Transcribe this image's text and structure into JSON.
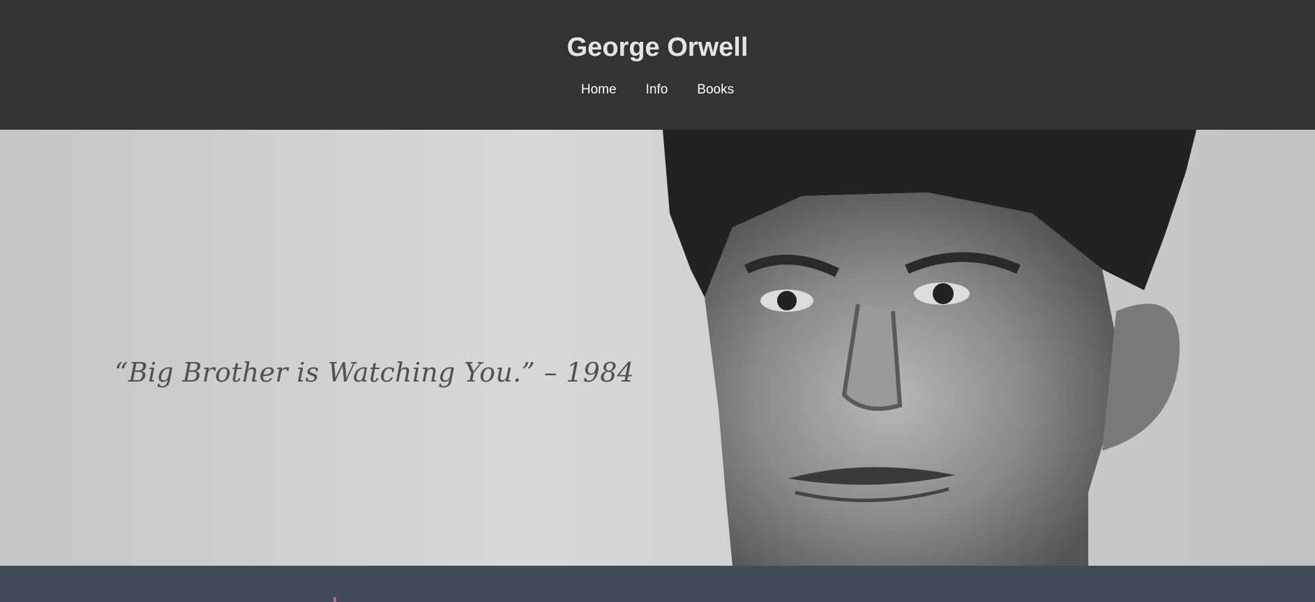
{
  "header": {
    "title": "George Orwell",
    "nav": [
      {
        "label": "Home"
      },
      {
        "label": "Info"
      },
      {
        "label": "Books"
      }
    ]
  },
  "hero": {
    "quote": "“Big Brother is Watching You.” – 1984"
  },
  "colors": {
    "header_bg": "#333333",
    "title_color": "#e4e4e4",
    "footer_bg": "#424c56",
    "quote_color": "#555050"
  }
}
